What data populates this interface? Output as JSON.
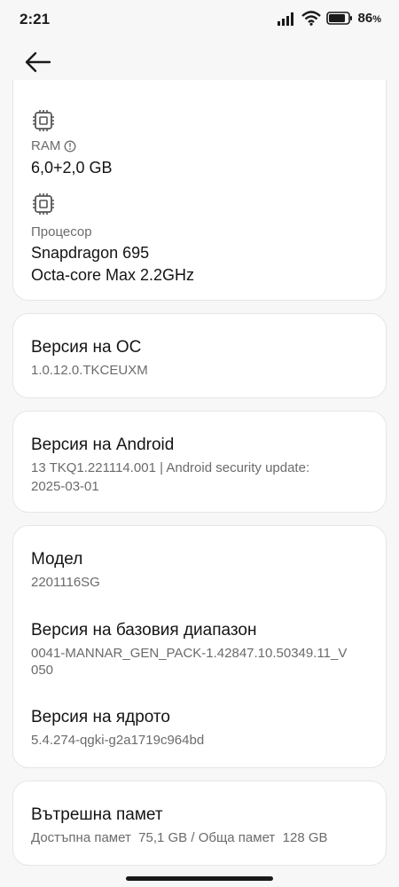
{
  "status_bar": {
    "time": "2:21",
    "battery": "86",
    "battery_unit": "%"
  },
  "hardware": {
    "ram_label": "RAM",
    "ram_value": "6,0+2,0 GB",
    "cpu_label": "Процесор",
    "cpu_line1": "Snapdragon 695",
    "cpu_line2": "Octa-core Max 2.2GHz"
  },
  "os_version": {
    "title": "Версия на ОС",
    "value": "1.0.12.0.TKCEUXM"
  },
  "android_version": {
    "title": "Версия на Android",
    "line1": "13 TKQ1.221114.001 | Android security update:",
    "line2": "2025-03-01"
  },
  "device_info": {
    "model_title": "Модел",
    "model_value": "2201116SG",
    "baseband_title": "Версия на базовия диапазон",
    "baseband_line1": "0041-MANNAR_GEN_PACK-1.42847.10.50349.11_V",
    "baseband_line2": "050",
    "kernel_title": "Версия на ядрото",
    "kernel_value": "5.4.274-qgki-g2a1719c964bd"
  },
  "storage": {
    "title": "Вътрешна памет",
    "value": "Достъпна памет  75,1 GB / Обща памет  128 GB"
  }
}
